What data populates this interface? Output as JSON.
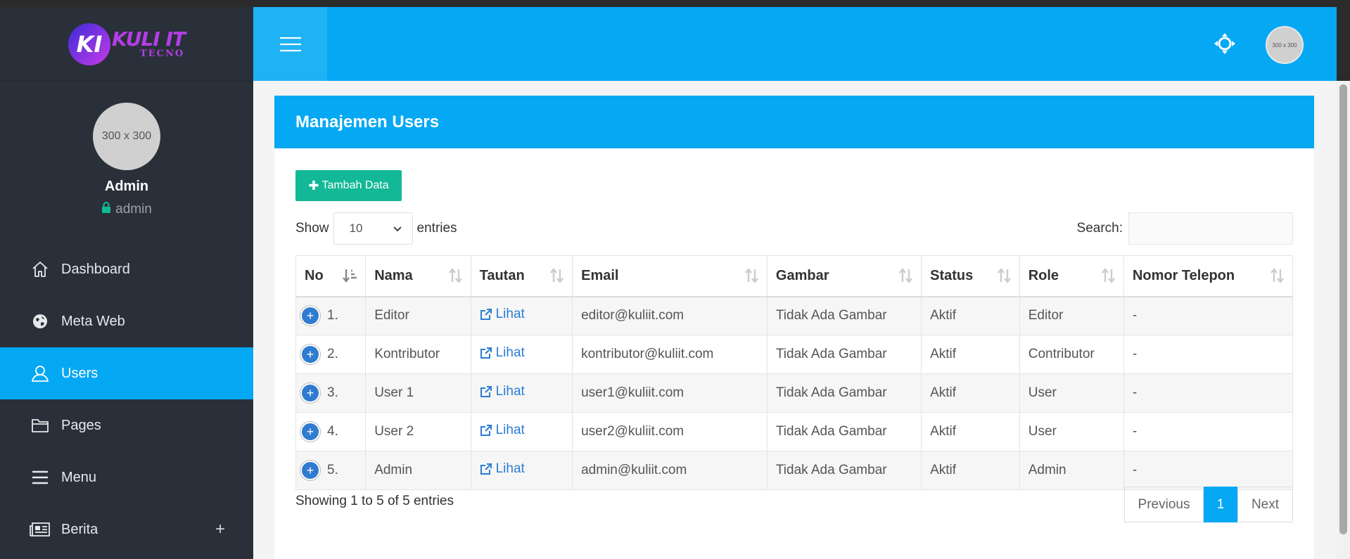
{
  "brand": {
    "mark": "KI",
    "name": "KULI IT",
    "sub": "TECNO"
  },
  "profile": {
    "avatar_text": "300 x 300",
    "name": "Admin",
    "role": "admin"
  },
  "nav": [
    {
      "label": "Dashboard",
      "icon": "home-icon"
    },
    {
      "label": "Meta Web",
      "icon": "globe-icon"
    },
    {
      "label": "Users",
      "icon": "user-icon",
      "active": true
    },
    {
      "label": "Pages",
      "icon": "folder-icon"
    },
    {
      "label": "Menu",
      "icon": "menu-icon"
    },
    {
      "label": "Berita",
      "icon": "newspaper-icon",
      "expand": "+"
    }
  ],
  "header": {
    "avatar_text": "300 x 300"
  },
  "card": {
    "title": "Manajemen Users",
    "add_button": "Tambah Data"
  },
  "length": {
    "show": "Show",
    "value": "10",
    "entries": "entries"
  },
  "search": {
    "label": "Search:",
    "value": ""
  },
  "table": {
    "columns": [
      "No",
      "Nama",
      "Tautan",
      "Email",
      "Gambar",
      "Status",
      "Role",
      "Nomor Telepon"
    ],
    "rows": [
      {
        "no": "1.",
        "nama": "Editor",
        "tautan": "Lihat",
        "email": "editor@kuliit.com",
        "gambar": "Tidak Ada Gambar",
        "status": "Aktif",
        "role": "Editor",
        "telepon": "-"
      },
      {
        "no": "2.",
        "nama": "Kontributor",
        "tautan": "Lihat",
        "email": "kontributor@kuliit.com",
        "gambar": "Tidak Ada Gambar",
        "status": "Aktif",
        "role": "Contributor",
        "telepon": "-"
      },
      {
        "no": "3.",
        "nama": "User 1",
        "tautan": "Lihat",
        "email": "user1@kuliit.com",
        "gambar": "Tidak Ada Gambar",
        "status": "Aktif",
        "role": "User",
        "telepon": "-"
      },
      {
        "no": "4.",
        "nama": "User 2",
        "tautan": "Lihat",
        "email": "user2@kuliit.com",
        "gambar": "Tidak Ada Gambar",
        "status": "Aktif",
        "role": "User",
        "telepon": "-"
      },
      {
        "no": "5.",
        "nama": "Admin",
        "tautan": "Lihat",
        "email": "admin@kuliit.com",
        "gambar": "Tidak Ada Gambar",
        "status": "Aktif",
        "role": "Admin",
        "telepon": "-"
      }
    ]
  },
  "footer": {
    "info": "Showing 1 to 5 of 5 entries",
    "previous": "Previous",
    "current_page": "1",
    "next": "Next"
  },
  "colors": {
    "accent": "#05a8f3",
    "sidebar": "#2a3039",
    "add_button": "#13b896",
    "link": "#2a7dd4"
  }
}
